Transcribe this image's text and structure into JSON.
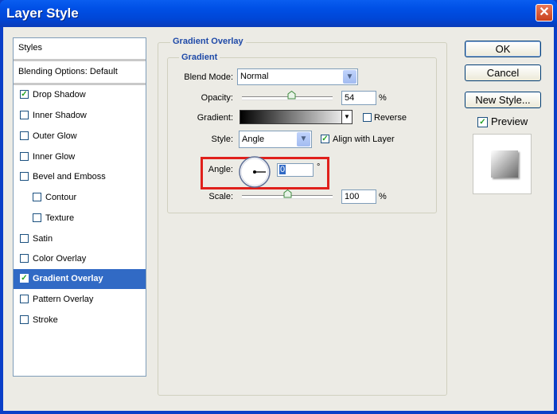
{
  "window": {
    "title": "Layer Style",
    "close_glyph": "✕"
  },
  "sidebar": {
    "items": [
      {
        "label": "Styles"
      },
      {
        "label": "Blending Options: Default"
      },
      {
        "label": "Drop Shadow",
        "checked": true
      },
      {
        "label": "Inner Shadow",
        "checked": false
      },
      {
        "label": "Outer Glow",
        "checked": false
      },
      {
        "label": "Inner Glow",
        "checked": false
      },
      {
        "label": "Bevel and Emboss",
        "checked": false
      },
      {
        "label": "Contour",
        "checked": false
      },
      {
        "label": "Texture",
        "checked": false
      },
      {
        "label": "Satin",
        "checked": false
      },
      {
        "label": "Color Overlay",
        "checked": false
      },
      {
        "label": "Gradient Overlay",
        "checked": true,
        "selected": true
      },
      {
        "label": "Pattern Overlay",
        "checked": false
      },
      {
        "label": "Stroke",
        "checked": false
      }
    ]
  },
  "gradient_overlay": {
    "section_title": "Gradient Overlay",
    "group_title": "Gradient",
    "blend_mode": {
      "label": "Blend Mode:",
      "value": "Normal"
    },
    "opacity": {
      "label": "Opacity:",
      "value": "54",
      "unit": "%",
      "level": 0.54
    },
    "gradient": {
      "label": "Gradient:",
      "reverse_label": "Reverse",
      "reverse_checked": false
    },
    "style": {
      "label": "Style:",
      "value": "Angle",
      "align_label": "Align with Layer",
      "align_checked": true
    },
    "angle": {
      "label": "Angle:",
      "value": "0",
      "unit": "°"
    },
    "scale": {
      "label": "Scale:",
      "value": "100",
      "unit": "%",
      "level": 0.5
    }
  },
  "buttons": {
    "ok": "OK",
    "cancel": "Cancel",
    "new_style": "New Style...",
    "preview_label": "Preview",
    "preview_checked": true
  },
  "colors": {
    "titlebar": "#0054e3",
    "selection": "#316ac5",
    "group_title": "#1f4aa8",
    "highlight_box": "#e0201b"
  }
}
